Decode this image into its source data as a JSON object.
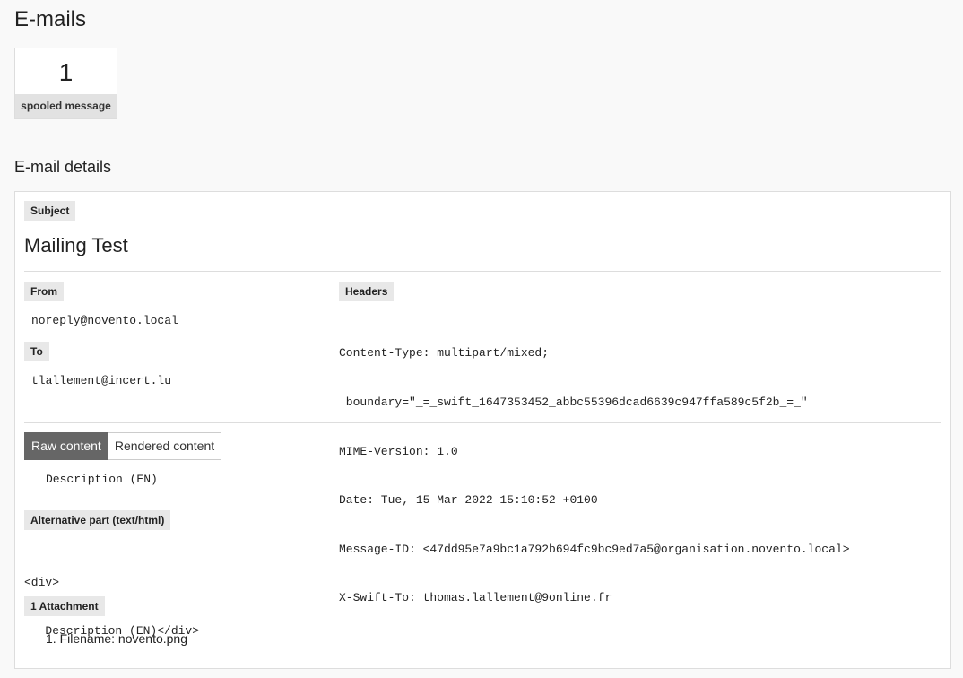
{
  "page": {
    "title": "E-mails"
  },
  "counter": {
    "value": "1",
    "label": "spooled message"
  },
  "details": {
    "title": "E-mail details",
    "subject_label": "Subject",
    "subject": "Mailing Test",
    "from_label": "From",
    "from": "noreply@novento.local",
    "to_label": "To",
    "to": "tlallement@incert.lu",
    "headers_label": "Headers",
    "headers": [
      "Content-Type: multipart/mixed;",
      " boundary=\"_=_swift_1647353452_abbc55396dcad6639c947ffa589c5f2b_=_\"",
      "MIME-Version: 1.0",
      "Date: Tue, 15 Mar 2022 15:10:52 +0100",
      "Message-ID: <47dd95e7a9bc1a792b694fc9bc9ed7a5@organisation.novento.local>",
      "X-Swift-To: thomas.lallement@9online.fr"
    ],
    "tabs": {
      "raw": "Raw content",
      "rendered": "Rendered content"
    },
    "raw_content": "Description (EN)",
    "alt_part_label": "Alternative part (text/html)",
    "alt_part_lines": [
      "<div>",
      "   Description (EN)</div>"
    ],
    "attachments_label": "1 Attachment",
    "attachments": [
      {
        "index": "1.",
        "text": "Filename: novento.png"
      }
    ]
  }
}
